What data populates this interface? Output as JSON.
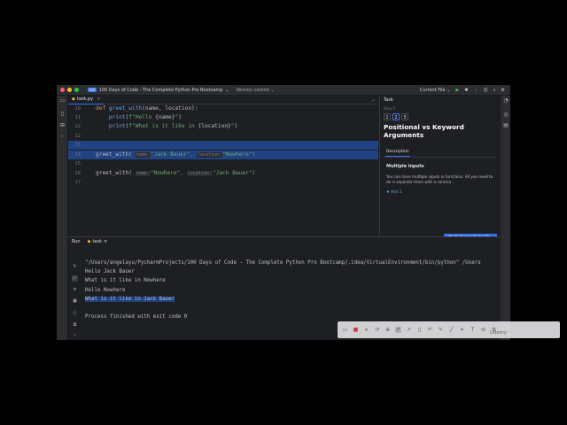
{
  "window": {
    "dot_colors": [
      "#ff5f57",
      "#febc2e",
      "#28c840"
    ],
    "project_badge": "100",
    "project_name": "100 Days of Code - The Complete Python Pro Bootcamp",
    "version_control": "Version control",
    "run_config": "Current File"
  },
  "editor": {
    "tab_label": "task.py",
    "lines": [
      {
        "num": "10",
        "text": "def greet_with(name, location):"
      },
      {
        "num": "11",
        "text": "    print(f\"Hello {name}\")"
      },
      {
        "num": "12",
        "text": "    print(f\"What is it like in {location}\")"
      },
      {
        "num": "12",
        "text": ""
      },
      {
        "num": "13",
        "text": ""
      },
      {
        "num": "14",
        "text": "greet_with(",
        "hint1": "name:",
        "arg1": "\"Jack Bauer\",",
        "hint2": "location:",
        "arg2": "\"Nowhere\")"
      },
      {
        "num": "15",
        "text": ""
      },
      {
        "num": "16",
        "text": "greet_with(",
        "hint1": "name:",
        "arg1": "\"Nowhere\",",
        "hint2": "location:",
        "arg2": "\"Jack Bauer\")"
      },
      {
        "num": "17",
        "text": ""
      }
    ]
  },
  "task": {
    "header": "Task",
    "step_label": "Step 3",
    "steps": [
      "1",
      "2",
      "3"
    ],
    "title": "Positional vs Keyword Arguments",
    "description_tab": "Description",
    "subtitle": "Multiple inputs",
    "body": "You can have multiple inputs in functions. All you need to do is separate them with a comma , .",
    "hint": "Hint 1",
    "next_button": "Next: Caesar Cipher Pr..."
  },
  "run": {
    "tab_run": "Run",
    "tab_task": "task",
    "console": [
      "\"/Users/angelayu/PycharmProjects/100 Days of Code - The Complete Python Pro Bootcamp/.idea/VirtualEnvironment/bin/python\" /Users",
      "Hello Jack Bauer",
      "What is it like in Nowhere",
      "Hello Nowhere",
      "What is it like in Jack Bauer",
      "",
      "Process finished with exit code 0"
    ]
  },
  "overlay": {
    "watermark": "Udemy"
  }
}
